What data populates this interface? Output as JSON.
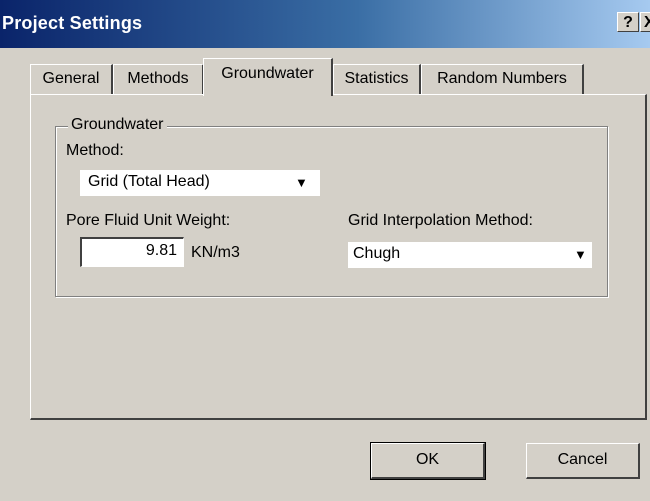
{
  "window": {
    "title": "Project Settings",
    "help_label": "?",
    "close_label": "X"
  },
  "tabs": [
    {
      "label": "General",
      "active": false
    },
    {
      "label": "Methods",
      "active": false
    },
    {
      "label": "Groundwater",
      "active": true
    },
    {
      "label": "Statistics",
      "active": false
    },
    {
      "label": "Random Numbers",
      "active": false
    }
  ],
  "groundwater": {
    "group_label": "Groundwater",
    "method_label": "Method:",
    "method_value": "Grid (Total Head)",
    "unit_weight_label": "Pore Fluid Unit Weight:",
    "unit_weight_value": "9.81",
    "unit_weight_units": "KN/m3",
    "interp_label": "Grid Interpolation Method:",
    "interp_value": "Chugh"
  },
  "buttons": {
    "ok": "OK",
    "cancel": "Cancel"
  }
}
